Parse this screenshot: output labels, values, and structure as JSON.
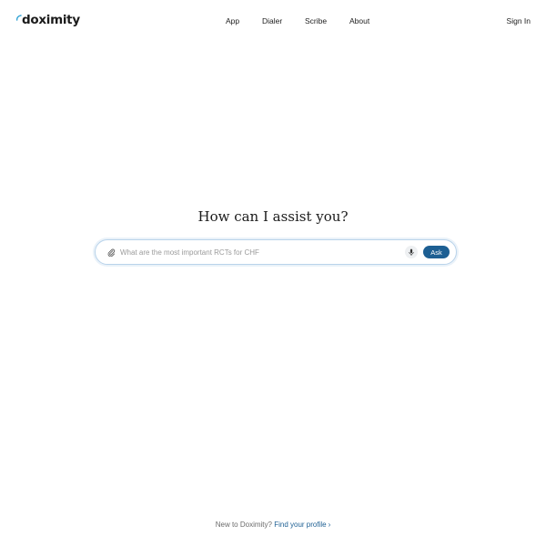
{
  "header": {
    "logo_text": "doximity",
    "nav": {
      "app": "App",
      "dialer": "Dialer",
      "scribe": "Scribe",
      "about": "About"
    },
    "sign_in": "Sign In"
  },
  "main": {
    "title": "How can I assist you?",
    "search": {
      "placeholder": "What are the most important RCTs for CHF",
      "value": "",
      "ask_label": "Ask",
      "attach_icon": "paperclip-icon",
      "mic_icon": "microphone-icon"
    }
  },
  "footer": {
    "prompt": "New to Doximity?",
    "link": "Find your profile",
    "chevron": "›"
  },
  "colors": {
    "brand_blue": "#1d5f93",
    "input_border": "#b9d3ea",
    "logo_accent": "#3aa7d6"
  }
}
